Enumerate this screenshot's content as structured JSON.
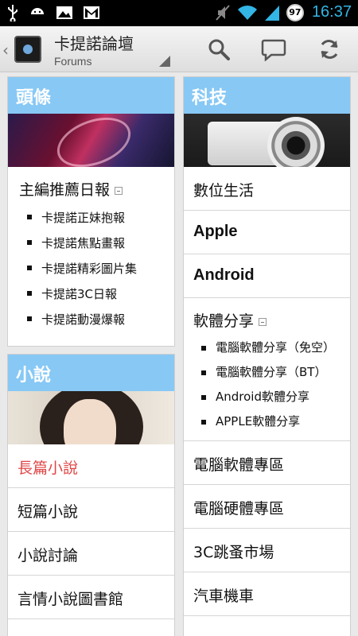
{
  "status_bar": {
    "time": "16:37",
    "battery_level": "97",
    "icons": [
      "usb-icon",
      "android-icon",
      "image-icon",
      "gmail-icon",
      "mute-icon",
      "wifi-icon",
      "signal-icon"
    ]
  },
  "action_bar": {
    "title": "卡提諾論壇",
    "subtitle": "Forums",
    "actions": [
      "search-icon",
      "chat-bubble-icon",
      "refresh-icon"
    ]
  },
  "left_column": {
    "headlines": {
      "header": "頭條",
      "section_title": "主編推薦日報",
      "items": [
        "卡提諾正妹抱報",
        "卡提諾焦點畫報",
        "卡提諾精彩圖片集",
        "卡提諾3C日報",
        "卡提諾動漫爆報"
      ]
    },
    "novels": {
      "header": "小說",
      "rows": [
        "長篇小說",
        "短篇小說",
        "小說討論",
        "言情小說圖書館"
      ],
      "active_color": "#e04545"
    }
  },
  "right_column": {
    "header": "科技",
    "rows_top": [
      "數位生活",
      "Apple",
      "Android"
    ],
    "software": {
      "title": "軟體分享",
      "items": [
        "電腦軟體分享（免空）",
        "電腦軟體分享（BT）",
        "Android軟體分享",
        "APPLE軟體分享"
      ]
    },
    "rows_bottom": [
      "電腦軟體專區",
      "電腦硬體專區",
      "3C跳蚤市場",
      "汽車機車"
    ]
  },
  "colors": {
    "category_header": "#87c8f5",
    "status_clock": "#33b5e5"
  }
}
